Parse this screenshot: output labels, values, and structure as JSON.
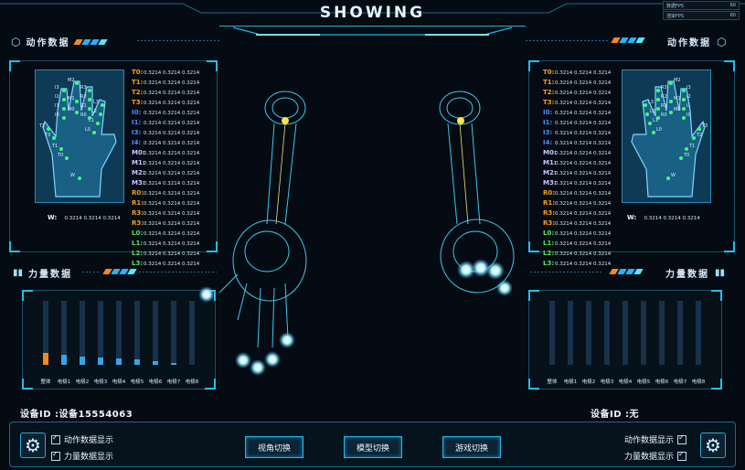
{
  "app": {
    "title": "SHOWING"
  },
  "fps": [
    {
      "label": "数据FPS",
      "value": "60"
    },
    {
      "label": "渲染FPS",
      "value": "60"
    }
  ],
  "left": {
    "motion_title": "动作数据",
    "force_title": "力量数据",
    "device_label": "设备ID :设备15554063",
    "hand_labels": [
      "M2",
      "R3",
      "R2",
      "R1",
      "R0",
      "M1",
      "M0",
      "I3",
      "I2",
      "I1",
      "I0",
      "L3",
      "L2",
      "L1",
      "L0",
      "T2",
      "T3",
      "T1",
      "T0",
      "W"
    ],
    "w_row": {
      "label": "W:",
      "vals": "0.3214  0.3214  0.3214"
    },
    "rows": [
      {
        "label": "T0:",
        "vals": "0.3214  0.3214  0.3214",
        "color": "#f4a020"
      },
      {
        "label": "T1:",
        "vals": "0.3214  0.3214  0.3214",
        "color": "#f4a020"
      },
      {
        "label": "T2:",
        "vals": "0.3214  0.3214  0.3214",
        "color": "#f4a020"
      },
      {
        "label": "T3:",
        "vals": "0.3214  0.3214  0.3214",
        "color": "#f4a020"
      },
      {
        "label": "I0:",
        "vals": "0.3214  0.3214  0.3214",
        "color": "#4f8cff"
      },
      {
        "label": "I1:",
        "vals": "0.3214  0.3214  0.3214",
        "color": "#4f8cff"
      },
      {
        "label": "I3:",
        "vals": "0.3214  0.3214  0.3214",
        "color": "#4f8cff"
      },
      {
        "label": "I4:",
        "vals": "0.3214  0.3214  0.3214",
        "color": "#4f8cff"
      },
      {
        "label": "M0:",
        "vals": "0.3214  0.3214  0.3214",
        "color": "#c9c9ff"
      },
      {
        "label": "M1:",
        "vals": "0.3214  0.3214  0.3214",
        "color": "#c9c9ff"
      },
      {
        "label": "M2:",
        "vals": "0.3214  0.3214  0.3214",
        "color": "#c9c9ff"
      },
      {
        "label": "M3:",
        "vals": "0.3214  0.3214  0.3214",
        "color": "#c9c9ff"
      },
      {
        "label": "R0:",
        "vals": "0.3214  0.3214  0.3214",
        "color": "#f4a020"
      },
      {
        "label": "R1:",
        "vals": "0.3214  0.3214  0.3214",
        "color": "#f4a020"
      },
      {
        "label": "R3:",
        "vals": "0.3214  0.3214  0.3214",
        "color": "#f4a020"
      },
      {
        "label": "R3:",
        "vals": "0.3214  0.3214  0.3214",
        "color": "#f4a020"
      },
      {
        "label": "L0:",
        "vals": "0.3214  0.3214  0.3214",
        "color": "#5ee05e"
      },
      {
        "label": "L1:",
        "vals": "0.3214  0.3214  0.3214",
        "color": "#5ee05e"
      },
      {
        "label": "L2:",
        "vals": "0.3214  0.3214  0.3214",
        "color": "#5ee05e"
      },
      {
        "label": "L3:",
        "vals": "0.3214  0.3214  0.3214",
        "color": "#5ee05e"
      }
    ],
    "bars": [
      {
        "label": "整体",
        "value": 0.18,
        "color": "#f08a1c"
      },
      {
        "label": "电极1",
        "value": 0.16,
        "color": "#3aa3e8"
      },
      {
        "label": "电极2",
        "value": 0.13,
        "color": "#3aa3e8"
      },
      {
        "label": "电极3",
        "value": 0.11,
        "color": "#3aa3e8"
      },
      {
        "label": "电极4",
        "value": 0.1,
        "color": "#3aa3e8"
      },
      {
        "label": "电极5",
        "value": 0.08,
        "color": "#3aa3e8"
      },
      {
        "label": "电极6",
        "value": 0.05,
        "color": "#3aa3e8"
      },
      {
        "label": "电极7",
        "value": 0.03,
        "color": "#3aa3e8"
      },
      {
        "label": "电极8",
        "value": 0.0,
        "color": "#3aa3e8"
      }
    ]
  },
  "right": {
    "motion_title": "动作数据",
    "force_title": "力量数据",
    "device_label": "设备ID :无",
    "hand_labels": [
      "M2",
      "R3",
      "R2",
      "R1",
      "R0",
      "M1",
      "M0",
      "I3",
      "I2",
      "I1",
      "I0",
      "L3",
      "L2",
      "L1",
      "L0",
      "T3",
      "T2",
      "T1",
      "T0",
      "W"
    ],
    "w_row": {
      "label": "W:",
      "vals": "0.3214  0.3214  0.3214"
    },
    "rows": [
      {
        "label": "T0:",
        "vals": "0.3214  0.3214  0.3214",
        "color": "#f4a020"
      },
      {
        "label": "T1:",
        "vals": "0.3214  0.3214  0.3214",
        "color": "#f4a020"
      },
      {
        "label": "T2:",
        "vals": "0.3214  0.3214  0.3214",
        "color": "#f4a020"
      },
      {
        "label": "T3:",
        "vals": "0.3214  0.3214  0.3214",
        "color": "#f4a020"
      },
      {
        "label": "I0:",
        "vals": "0.3214  0.3214  0.3214",
        "color": "#4f8cff"
      },
      {
        "label": "I1:",
        "vals": "0.3214  0.3214  0.3214",
        "color": "#4f8cff"
      },
      {
        "label": "I3:",
        "vals": "0.3214  0.3214  0.3214",
        "color": "#4f8cff"
      },
      {
        "label": "I4:",
        "vals": "0.3214  0.3214  0.3214",
        "color": "#4f8cff"
      },
      {
        "label": "M0:",
        "vals": "0.3214  0.3214  0.3214",
        "color": "#c9c9ff"
      },
      {
        "label": "M1:",
        "vals": "0.3214  0.3214  0.3214",
        "color": "#c9c9ff"
      },
      {
        "label": "M2:",
        "vals": "0.3214  0.3214  0.3214",
        "color": "#c9c9ff"
      },
      {
        "label": "M3:",
        "vals": "0.3214  0.3214  0.3214",
        "color": "#c9c9ff"
      },
      {
        "label": "R0:",
        "vals": "0.3214  0.3214  0.3214",
        "color": "#f4a020"
      },
      {
        "label": "R1:",
        "vals": "0.3214  0.3214  0.3214",
        "color": "#f4a020"
      },
      {
        "label": "R3:",
        "vals": "0.3214  0.3214  0.3214",
        "color": "#f4a020"
      },
      {
        "label": "R3:",
        "vals": "0.3214  0.3214  0.3214",
        "color": "#f4a020"
      },
      {
        "label": "L0:",
        "vals": "0.3214  0.3214  0.3214",
        "color": "#5ee05e"
      },
      {
        "label": "L1:",
        "vals": "0.3214  0.3214  0.3214",
        "color": "#5ee05e"
      },
      {
        "label": "L2:",
        "vals": "0.3214  0.3214  0.3214",
        "color": "#5ee05e"
      },
      {
        "label": "L3:",
        "vals": "0.3214  0.3214  0.3214",
        "color": "#5ee05e"
      }
    ],
    "bars": [
      {
        "label": "整体",
        "value": 0.0,
        "color": "#f08a1c"
      },
      {
        "label": "电极1",
        "value": 0.0,
        "color": "#3aa3e8"
      },
      {
        "label": "电极2",
        "value": 0.0,
        "color": "#3aa3e8"
      },
      {
        "label": "电极3",
        "value": 0.0,
        "color": "#3aa3e8"
      },
      {
        "label": "电极4",
        "value": 0.0,
        "color": "#3aa3e8"
      },
      {
        "label": "电极5",
        "value": 0.0,
        "color": "#3aa3e8"
      },
      {
        "label": "电极6",
        "value": 0.0,
        "color": "#3aa3e8"
      },
      {
        "label": "电极7",
        "value": 0.0,
        "color": "#3aa3e8"
      },
      {
        "label": "电极8",
        "value": 0.0,
        "color": "#3aa3e8"
      }
    ]
  },
  "footer": {
    "left_checks": [
      {
        "label": "动作数据显示",
        "checked": true
      },
      {
        "label": "力量数据显示",
        "checked": true
      }
    ],
    "right_checks": [
      {
        "label": "动作数据显示",
        "checked": true
      },
      {
        "label": "力量数据显示",
        "checked": true
      }
    ],
    "buttons": {
      "view": "视角切换",
      "model": "模型切换",
      "game": "游戏切换"
    }
  },
  "colors": {
    "accent": "#21c0ee",
    "frame": "#1b4e6a",
    "orange": "#f08a1c",
    "blue": "#3aa3e8"
  }
}
